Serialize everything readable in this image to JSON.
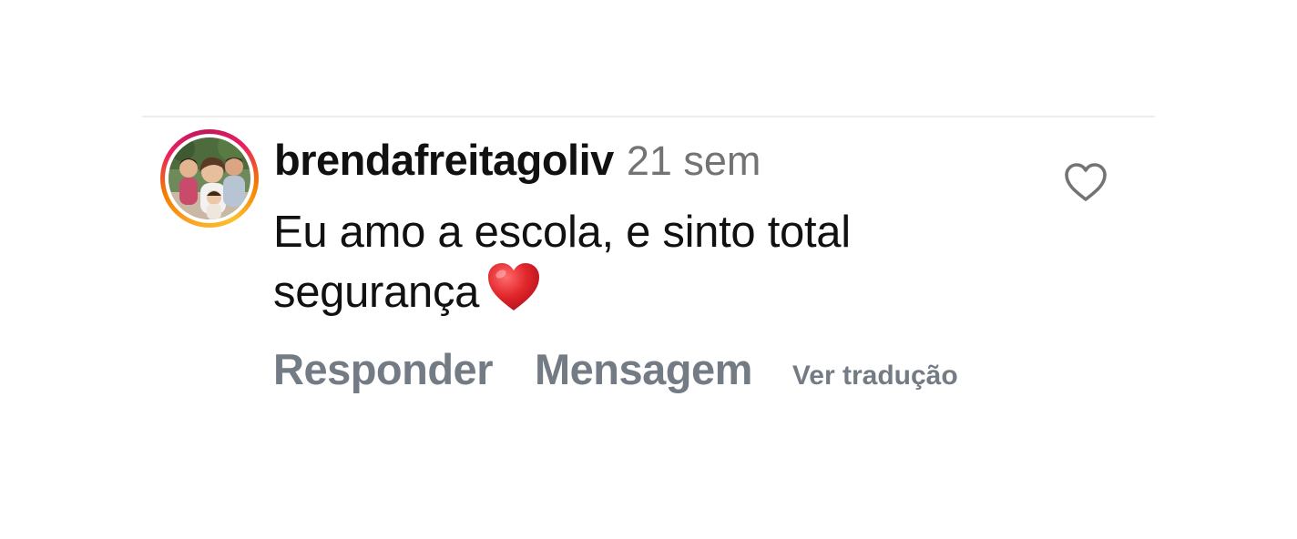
{
  "comment": {
    "username": "brendafreitagoliv",
    "timestamp": "21 sem",
    "text": "Eu amo a escola, e sinto total segurança",
    "emoji": "❤️"
  },
  "actions": {
    "reply_label": "Responder",
    "message_label": "Mensagem",
    "translate_label": "Ver tradução"
  },
  "icons": {
    "like": "heart-outline-icon",
    "emoji": "red-heart-icon"
  },
  "colors": {
    "text": "#111111",
    "muted": "#737373",
    "action": "#737b85",
    "emoji_red": "#e0262b"
  }
}
